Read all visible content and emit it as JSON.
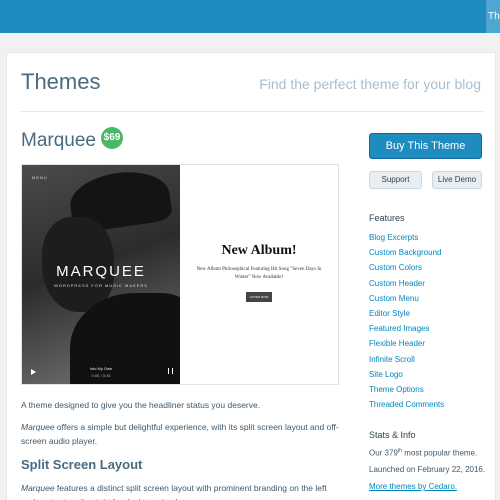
{
  "topbar": {
    "corner_text": "The"
  },
  "header": {
    "title": "Themes",
    "tagline": "Find the perfect theme for your blog"
  },
  "theme": {
    "name": "Marquee",
    "price": "$69"
  },
  "preview": {
    "menu_label": "MENU",
    "brand": "MARQUEE",
    "brand_sub": "WORDPRESS FOR MUSIC MAKERS",
    "album_title": "New Album!",
    "album_text": "New Album Philosophical Featuring Hit Song \"Seven Days In Winter\" Now Available!",
    "listen_button": "LISTEN NOW",
    "player_title": "Into My Own",
    "player_time": "0:00 / 3:15"
  },
  "description": {
    "intro": "A theme designed to give you the headliner status you deserve.",
    "para2_em": "Marquee",
    "para2": " offers a simple but delightful experience, with its split screen layout and off-screen audio player.",
    "subhead": "Split Screen Layout",
    "para3_em": "Marquee",
    "para3": " features a distinct split screen layout with prominent branding on the left and content on the right for desktop-sized screens."
  },
  "sidebar": {
    "buy_label": "Buy This Theme",
    "support_label": "Support",
    "demo_label": "Live Demo",
    "features_heading": "Features",
    "features": [
      "Blog Excerpts",
      "Custom Background",
      "Custom Colors",
      "Custom Header",
      "Custom Menu",
      "Editor Style",
      "Featured Images",
      "Flexible Header",
      "Infinite Scroll",
      "Site Logo",
      "Theme Options",
      "Threaded Comments"
    ],
    "stats_heading": "Stats & Info",
    "stat_rank_pre": "Our 379",
    "stat_rank_sup": "th",
    "stat_rank_post": " most popular theme.",
    "stat_launched": "Launched on February 22, 2016.",
    "stat_more": "More themes by Cedaro."
  },
  "colors": {
    "accent": "#1e8cbe",
    "price_badge": "#4ab866",
    "link": "#0087be"
  }
}
